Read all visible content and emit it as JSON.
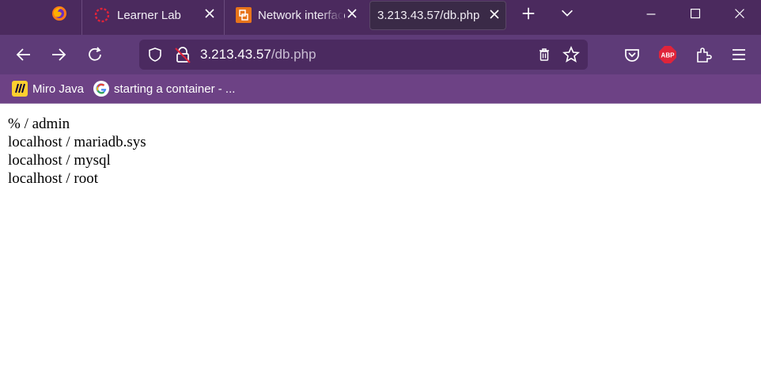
{
  "browser": {
    "tabs": [
      {
        "label": "Learner Lab",
        "icon": "learner-lab-icon",
        "active": false
      },
      {
        "label": "Network interface",
        "icon": "network-interface-icon",
        "active": false
      },
      {
        "label": "3.213.43.57/db.php",
        "icon": "",
        "active": true
      }
    ],
    "url": {
      "host": "3.213.43.57",
      "path": "/db.php"
    },
    "bookmarks": [
      {
        "label": "Miro Java",
        "icon": "miro-icon"
      },
      {
        "label": "starting a container - ...",
        "icon": "google-icon"
      }
    ],
    "colors": {
      "tabbar": "#4b2a5e",
      "navbar": "#5e3b78",
      "bookmarks_bar": "#6d4285",
      "adblock": "#e0243a"
    }
  },
  "page": {
    "rows": [
      "% / admin",
      "localhost / mariadb.sys",
      "localhost / mysql",
      "localhost / root"
    ]
  }
}
